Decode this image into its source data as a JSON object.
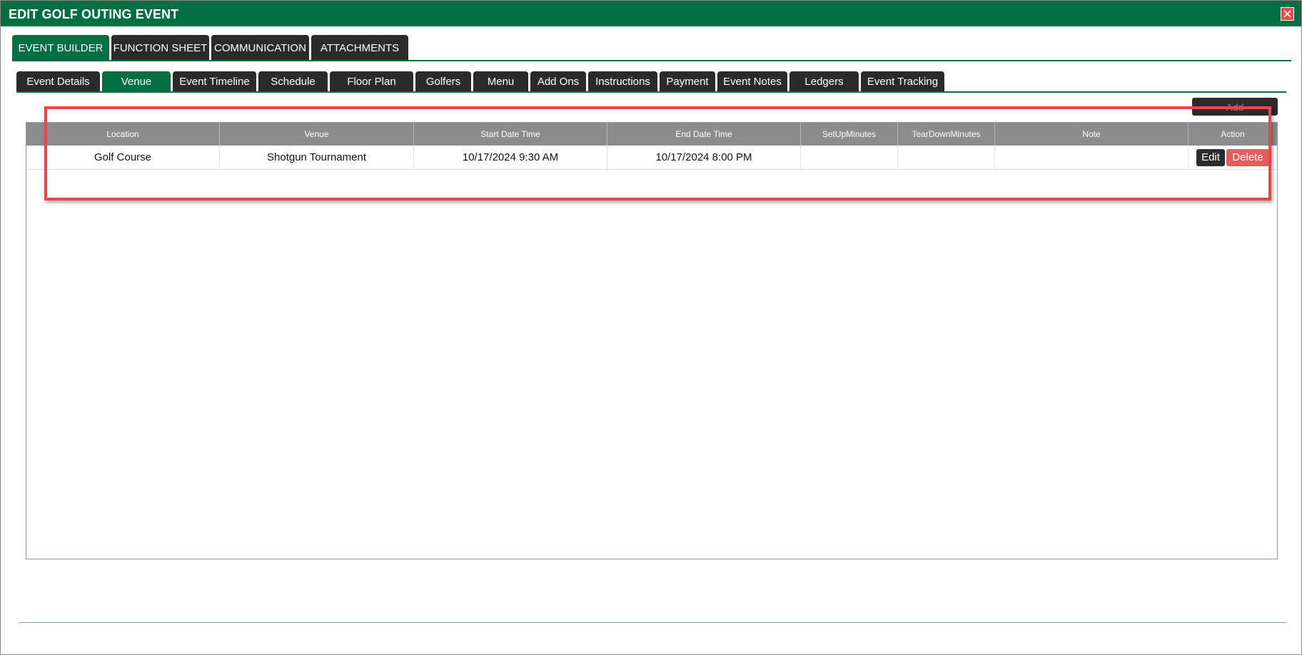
{
  "window": {
    "title": "EDIT GOLF OUTING EVENT"
  },
  "main_tabs": [
    {
      "label": "EVENT BUILDER",
      "active": true
    },
    {
      "label": "FUNCTION SHEET",
      "active": false
    },
    {
      "label": "COMMUNICATION",
      "active": false
    },
    {
      "label": "ATTACHMENTS",
      "active": false
    }
  ],
  "sub_tabs": [
    {
      "label": "Event Details",
      "active": false
    },
    {
      "label": "Venue",
      "active": true
    },
    {
      "label": "Event Timeline",
      "active": false
    },
    {
      "label": "Schedule",
      "active": false
    },
    {
      "label": "Floor Plan",
      "active": false
    },
    {
      "label": "Golfers",
      "active": false
    },
    {
      "label": "Menu",
      "active": false
    },
    {
      "label": "Add Ons",
      "active": false
    },
    {
      "label": "Instructions",
      "active": false
    },
    {
      "label": "Payment",
      "active": false
    },
    {
      "label": "Event Notes",
      "active": false
    },
    {
      "label": "Ledgers",
      "active": false
    },
    {
      "label": "Event Tracking",
      "active": false
    }
  ],
  "toolbar": {
    "add_label": "Add"
  },
  "grid": {
    "columns": [
      "Location",
      "Venue",
      "Start Date Time",
      "End Date Time",
      "SetUpMinutes",
      "TearDownMinutes",
      "Note",
      "Action"
    ],
    "rows": [
      {
        "location": "Golf Course",
        "venue": "Shotgun Tournament",
        "start": "10/17/2024 9:30 AM",
        "end": "10/17/2024 8:00 PM",
        "setup": "",
        "teardown": "",
        "note": "",
        "edit_label": "Edit",
        "delete_label": "Delete"
      }
    ]
  },
  "colors": {
    "brand_green": "#036e42",
    "tab_dark": "#2b2b2b",
    "header_gray": "#8c8c8c",
    "delete_red": "#e35d5d",
    "highlight_red": "#e8474c"
  }
}
